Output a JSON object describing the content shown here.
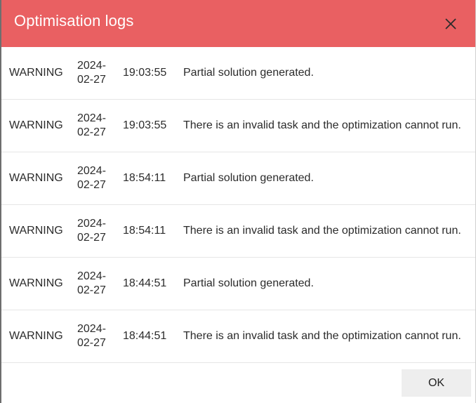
{
  "dialog": {
    "title": "Optimisation logs",
    "close_icon": "close-icon",
    "ok_label": "OK"
  },
  "logs": [
    {
      "level": "WARNING",
      "date": "2024-02-27",
      "time": "19:03:55",
      "message": "Partial solution generated."
    },
    {
      "level": "WARNING",
      "date": "2024-02-27",
      "time": "19:03:55",
      "message": "There is an invalid task and the optimization cannot run."
    },
    {
      "level": "WARNING",
      "date": "2024-02-27",
      "time": "18:54:11",
      "message": "Partial solution generated."
    },
    {
      "level": "WARNING",
      "date": "2024-02-27",
      "time": "18:54:11",
      "message": "There is an invalid task and the optimization cannot run."
    },
    {
      "level": "WARNING",
      "date": "2024-02-27",
      "time": "18:44:51",
      "message": "Partial solution generated."
    },
    {
      "level": "WARNING",
      "date": "2024-02-27",
      "time": "18:44:51",
      "message": "There is an invalid task and the optimization cannot run."
    }
  ],
  "colors": {
    "header": "#e96062",
    "button_bg": "#eeeeee"
  }
}
